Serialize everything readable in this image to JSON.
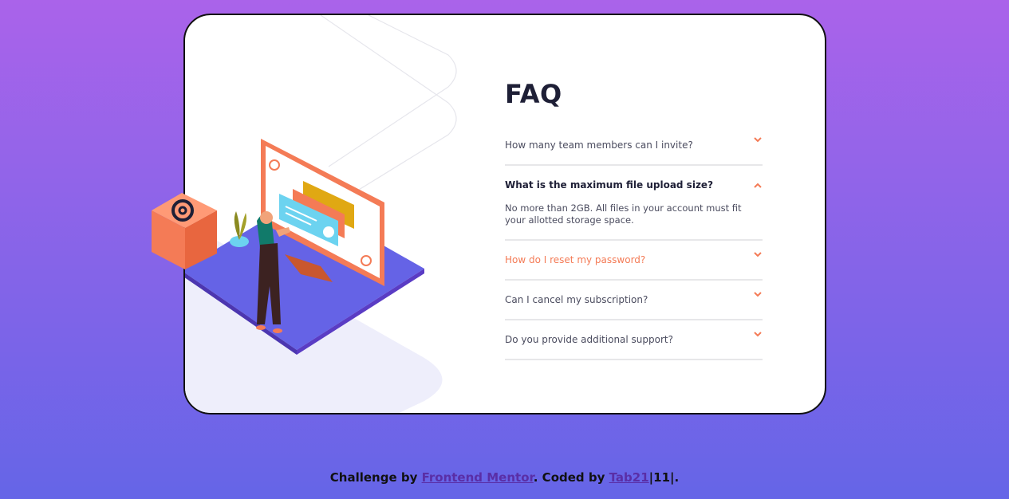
{
  "faq": {
    "title": "FAQ",
    "items": [
      {
        "question": "How many team members can I invite?",
        "state": "closed"
      },
      {
        "question": "What is the maximum file upload size?",
        "state": "open",
        "answer": "No more than 2GB. All files in your account must fit your allotted storage space."
      },
      {
        "question": "How do I reset my password?",
        "state": "hover"
      },
      {
        "question": "Can I cancel my subscription?",
        "state": "closed"
      },
      {
        "question": "Do you provide additional support?",
        "state": "closed"
      }
    ]
  },
  "footer": {
    "prefix": "Challenge by",
    "mentor_link": "Frontend Mentor",
    "middle": ". Coded by",
    "author_link": "Tab21",
    "suffix_a": "|11|",
    "suffix_b": "."
  },
  "colors": {
    "accent": "#f47b56",
    "heading": "#1e1f36",
    "text": "#4b4c5f",
    "divider": "#e7e7e9",
    "bg_top": "#aa63ea",
    "bg_bottom": "#6565e7"
  },
  "icons": {
    "chevron": "chevron-down-icon",
    "box_symbol": "at-sign-icon"
  }
}
